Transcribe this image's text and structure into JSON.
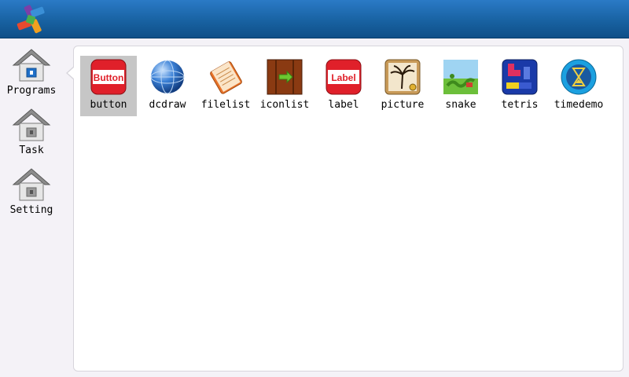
{
  "sidebar": {
    "items": [
      {
        "label": "Programs",
        "icon": "home-icon"
      },
      {
        "label": "Task",
        "icon": "home-icon"
      },
      {
        "label": "Setting",
        "icon": "home-icon"
      }
    ]
  },
  "apps": [
    {
      "name": "button",
      "icon": "button-app-icon",
      "icon_text": "Button",
      "selected": true
    },
    {
      "name": "dcdraw",
      "icon": "globe-icon"
    },
    {
      "name": "filelist",
      "icon": "notebook-icon"
    },
    {
      "name": "iconlist",
      "icon": "wood-box-icon"
    },
    {
      "name": "label",
      "icon": "label-app-icon",
      "icon_text": "Label"
    },
    {
      "name": "picture",
      "icon": "picture-icon"
    },
    {
      "name": "snake",
      "icon": "snake-icon"
    },
    {
      "name": "tetris",
      "icon": "tetris-icon"
    },
    {
      "name": "timedemo",
      "icon": "hourglass-icon"
    }
  ],
  "colors": {
    "topbar": "#17609f",
    "selection": "#c6c6c6",
    "app_red": "#e0202a"
  }
}
